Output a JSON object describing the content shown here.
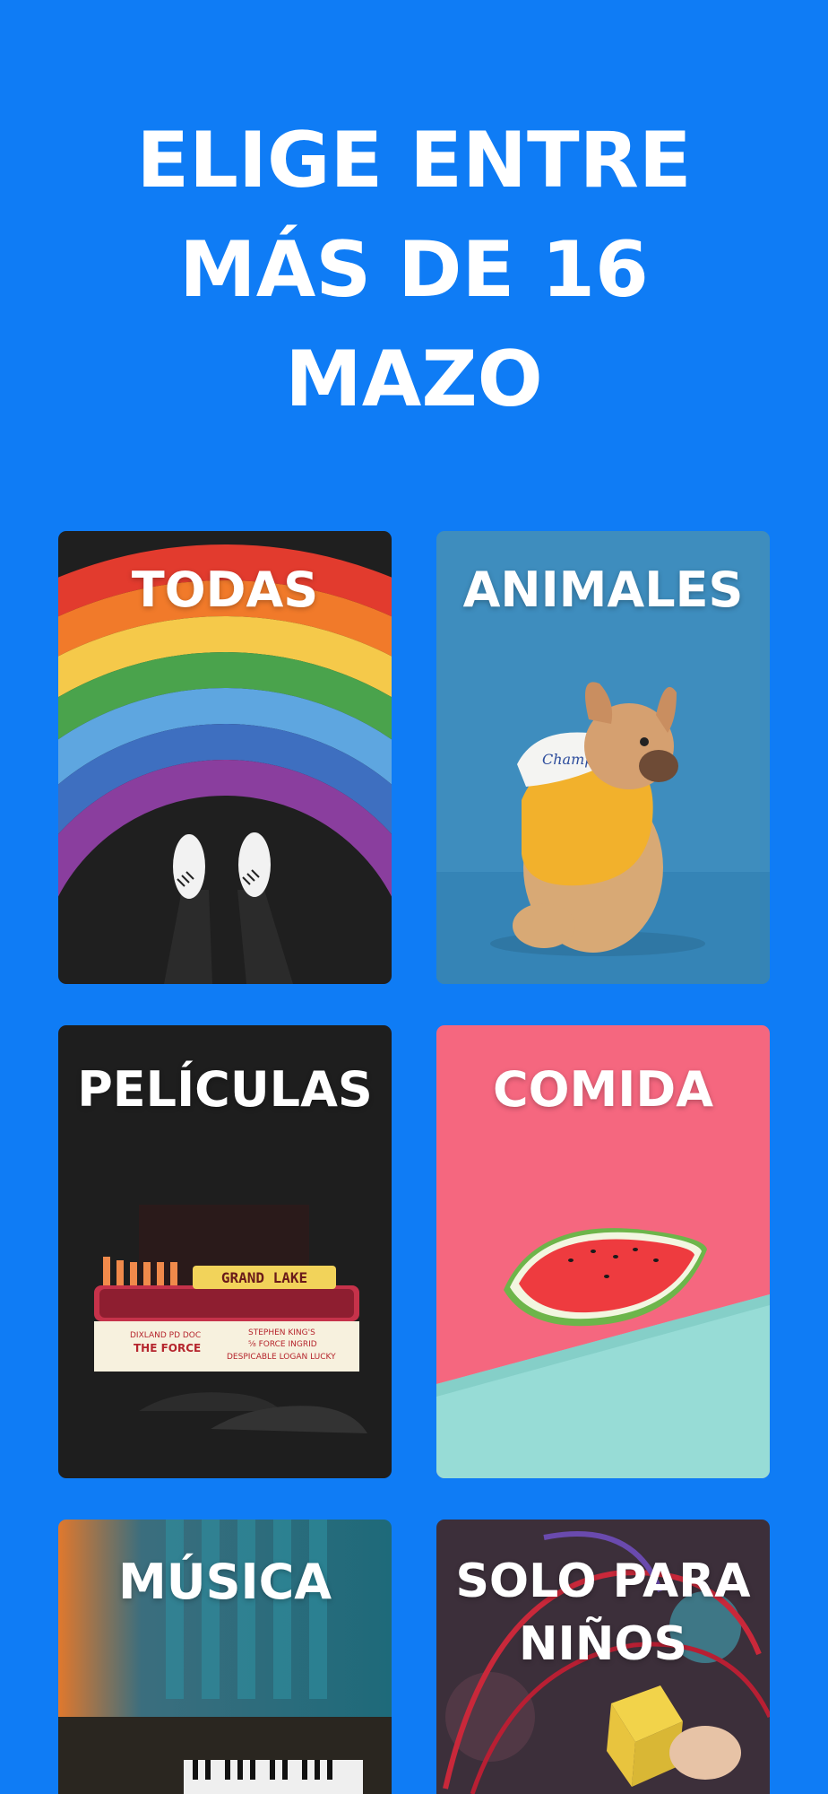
{
  "headline": {
    "line1": "ELIGE ENTRE",
    "line2": "MÁS DE 16",
    "line3": "MAZO"
  },
  "categories": [
    {
      "label": "TODAS"
    },
    {
      "label": "ANIMALES"
    },
    {
      "label": "PELÍCULAS"
    },
    {
      "label": "COMIDA"
    },
    {
      "label": "MÚSICA"
    },
    {
      "label_line1": "SOLO PARA",
      "label_line2": "NIÑOS"
    }
  ],
  "theater_sign": {
    "marquee": "GRAND LAKE",
    "left_line1": "DIXLAND PD DOC",
    "left_line2": "THE FORCE",
    "right_line1": "STEPHEN KING'S",
    "right_line2": "⅝ FORCE  INGRID",
    "right_line3": "DESPICABLE  LOGAN LUCKY"
  },
  "hoodie_text": "Champion",
  "colors": {
    "background": "#0F7CF5",
    "text": "#FFFFFF",
    "comida_bg": "#F5677F"
  }
}
